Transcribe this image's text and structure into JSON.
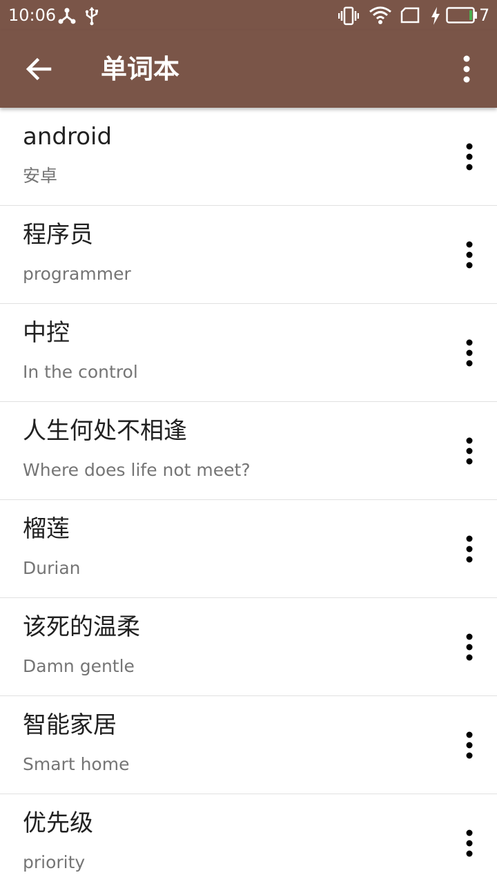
{
  "status_bar": {
    "time": "10:06",
    "battery_level": "7",
    "icons": [
      "usb-tether-icon",
      "usb-icon",
      "vibrate-icon",
      "wifi-icon",
      "sim-icon",
      "charging-icon",
      "battery-icon"
    ],
    "battery_fill_color": "#4caf50"
  },
  "app_bar": {
    "title": "单词本",
    "back_icon": "arrow-back-icon",
    "menu_icon": "more-vert-icon",
    "background_color": "#7a5548"
  },
  "words": [
    {
      "word": "android",
      "meaning": "安卓"
    },
    {
      "word": "程序员",
      "meaning": "programmer"
    },
    {
      "word": "中控",
      "meaning": "In the control"
    },
    {
      "word": "人生何处不相逢",
      "meaning": "Where does life not meet?"
    },
    {
      "word": "榴莲",
      "meaning": "Durian"
    },
    {
      "word": "该死的温柔",
      "meaning": "Damn gentle"
    },
    {
      "word": "智能家居",
      "meaning": "Smart home"
    },
    {
      "word": "优先级",
      "meaning": "priority"
    }
  ]
}
